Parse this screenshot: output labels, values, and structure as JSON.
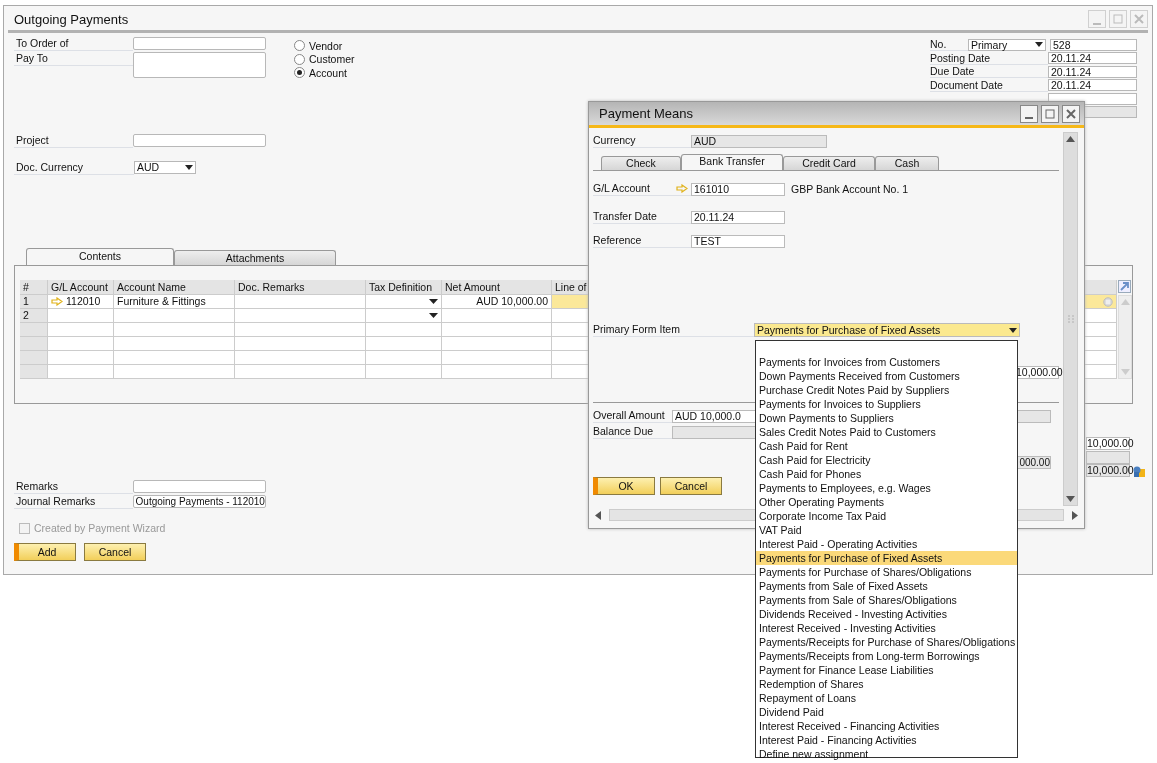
{
  "window": {
    "title": "Outgoing Payments"
  },
  "header_fields": [
    {
      "label": "To Order of",
      "kind": "input"
    },
    {
      "label": "Pay To",
      "kind": "textarea"
    },
    {
      "label": "Project",
      "kind": "input"
    },
    {
      "label": "Doc. Currency",
      "kind": "select",
      "value": "AUD"
    }
  ],
  "partner_type": [
    {
      "label": "Vendor",
      "selected": false
    },
    {
      "label": "Customer",
      "selected": false
    },
    {
      "label": "Account",
      "selected": true
    }
  ],
  "numbering": {
    "label": "No.",
    "series": "Primary",
    "number": "528"
  },
  "dates": [
    {
      "label": "Posting Date",
      "value": "20.11.24"
    },
    {
      "label": "Due Date",
      "value": "20.11.24"
    },
    {
      "label": "Document Date",
      "value": "20.11.24"
    }
  ],
  "tabs": [
    {
      "label": "Contents",
      "selected": true
    },
    {
      "label": "Attachments",
      "selected": false
    }
  ],
  "table": {
    "columns": [
      "#",
      "G/L Account",
      "Account Name",
      "Doc. Remarks",
      "Tax Definition",
      "Net Amount",
      "Line of"
    ],
    "rows": [
      {
        "num": "1",
        "gl_account": "112010",
        "account_name": "Furniture & Fittings",
        "net_amount": "AUD 10,000.00",
        "selected": true
      },
      {
        "num": "2",
        "selected": false
      }
    ]
  },
  "remarks": [
    {
      "label": "Remarks"
    },
    {
      "label": "Journal Remarks",
      "value": "Outgoing Payments - 112010"
    }
  ],
  "payment_wizard": {
    "label": "Created by Payment Wizard",
    "checked": false,
    "disabled": true
  },
  "buttons": [
    {
      "label": "Add",
      "kind": "primary"
    },
    {
      "label": "Cancel",
      "kind": "secondary"
    }
  ],
  "totals": [
    {
      "kind": "field",
      "value": "10,000.00"
    },
    {
      "kind": "readonly"
    },
    {
      "kind": "readonly",
      "value": "10,000.00"
    }
  ],
  "payment_means": {
    "title": "Payment Means",
    "currency": {
      "label": "Currency",
      "value": "AUD"
    },
    "tabs": [
      {
        "label": "Check",
        "selected": false
      },
      {
        "label": "Bank Transfer",
        "selected": true
      },
      {
        "label": "Credit Card",
        "selected": false
      },
      {
        "label": "Cash",
        "selected": false
      }
    ],
    "fields": [
      {
        "label": "G/L Account",
        "value": "161010",
        "note": "GBP Bank Account No. 1"
      },
      {
        "label": "Transfer Date",
        "value": "20.11.24"
      },
      {
        "label": "Reference",
        "value": "TEST"
      }
    ],
    "primary_form_item": {
      "label": "Primary Form Item",
      "value": "Payments for Purchase of Fixed Assets",
      "options": [
        {
          "label": "Payments for Invoices from Customers",
          "selected": false
        },
        {
          "label": "Down Payments Received from Customers",
          "selected": false
        },
        {
          "label": "Purchase Credit Notes Paid by Suppliers",
          "selected": false
        },
        {
          "label": "Payments for Invoices to Suppliers",
          "selected": false
        },
        {
          "label": "Down Payments to Suppliers",
          "selected": false
        },
        {
          "label": "Sales Credit Notes Paid to Customers",
          "selected": false
        },
        {
          "label": "Cash Paid for Rent",
          "selected": false
        },
        {
          "label": "Cash Paid for Electricity",
          "selected": false
        },
        {
          "label": "Cash Paid for Phones",
          "selected": false
        },
        {
          "label": "Payments to Employees, e.g. Wages",
          "selected": false
        },
        {
          "label": "Other Operating Payments",
          "selected": false
        },
        {
          "label": "Corporate Income Tax Paid",
          "selected": false
        },
        {
          "label": "VAT Paid",
          "selected": false
        },
        {
          "label": "Interest Paid - Operating Activities",
          "selected": false
        },
        {
          "label": "Payments for Purchase of Fixed Assets",
          "selected": true
        },
        {
          "label": "Payments for Purchase of Shares/Obligations",
          "selected": false
        },
        {
          "label": "Payments from Sale of Fixed Assets",
          "selected": false
        },
        {
          "label": "Payments from Sale of Shares/Obligations",
          "selected": false
        },
        {
          "label": "Dividends Received - Investing Activities",
          "selected": false
        },
        {
          "label": "Interest Received  - Investing Activities",
          "selected": false
        },
        {
          "label": "Payments/Receipts for Purchase of Shares/Obligations",
          "selected": false
        },
        {
          "label": "Payments/Receipts from Long-term Borrowings",
          "selected": false
        },
        {
          "label": "Payment for Finance Lease Liabilities",
          "selected": false
        },
        {
          "label": "Redemption of Shares",
          "selected": false
        },
        {
          "label": "Repayment of Loans",
          "selected": false
        },
        {
          "label": "Dividend Paid",
          "selected": false
        },
        {
          "label": "Interest Received  - Financing Activities",
          "selected": false
        },
        {
          "label": "Interest Paid - Financing Activities",
          "selected": false
        },
        {
          "label": "Define new assignment",
          "selected": false
        }
      ]
    },
    "partial_amount": "10,000.00",
    "overall_amount": {
      "label": "Overall Amount",
      "value": "AUD 10,000.0"
    },
    "balance_due": {
      "label": "Balance Due"
    },
    "partial_amount_2": "000.00",
    "buttons": [
      {
        "label": "OK",
        "kind": "primary"
      },
      {
        "label": "Cancel",
        "kind": "secondary"
      }
    ]
  }
}
